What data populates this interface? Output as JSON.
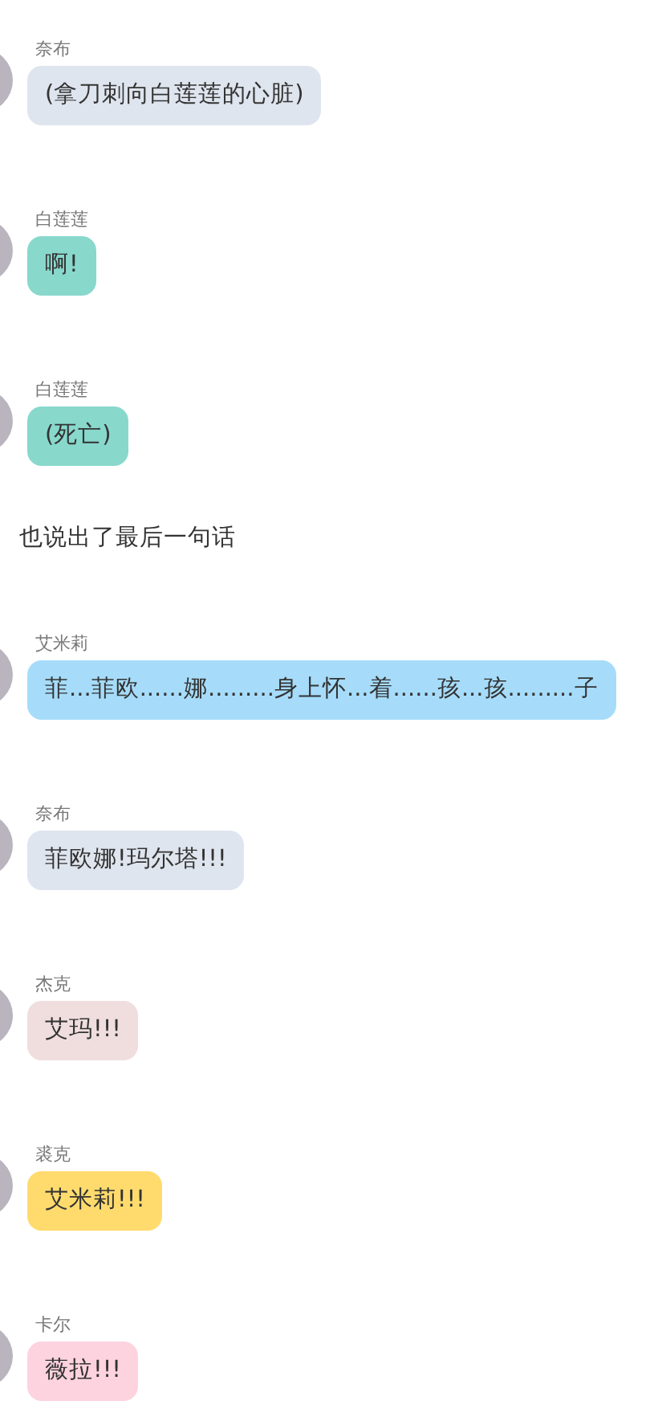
{
  "messages": [
    {
      "kind": "chat",
      "speaker": "奈布",
      "text": "(拿刀刺向白莲莲的心脏)",
      "color": "#dfe5ee"
    },
    {
      "kind": "chat",
      "speaker": "白莲莲",
      "text": "啊!",
      "color": "#88d8cc"
    },
    {
      "kind": "chat",
      "speaker": "白莲莲",
      "text": "(死亡)",
      "color": "#88d8cc"
    },
    {
      "kind": "narration",
      "text": "也说出了最后一句话"
    },
    {
      "kind": "chat",
      "speaker": "艾米莉",
      "text": "菲...菲欧......娜.........身上怀...着......孩...孩.........子",
      "color": "#a6dcfa"
    },
    {
      "kind": "chat",
      "speaker": "奈布",
      "text": "菲欧娜!玛尔塔!!!",
      "color": "#dfe5ee"
    },
    {
      "kind": "chat",
      "speaker": "杰克",
      "text": "艾玛!!!",
      "color": "#f0dede"
    },
    {
      "kind": "chat",
      "speaker": "裘克",
      "text": "艾米莉!!!",
      "color": "#ffdb6e"
    },
    {
      "kind": "chat",
      "speaker": "卡尔",
      "text": "薇拉!!!",
      "color": "#fdd3df"
    }
  ]
}
